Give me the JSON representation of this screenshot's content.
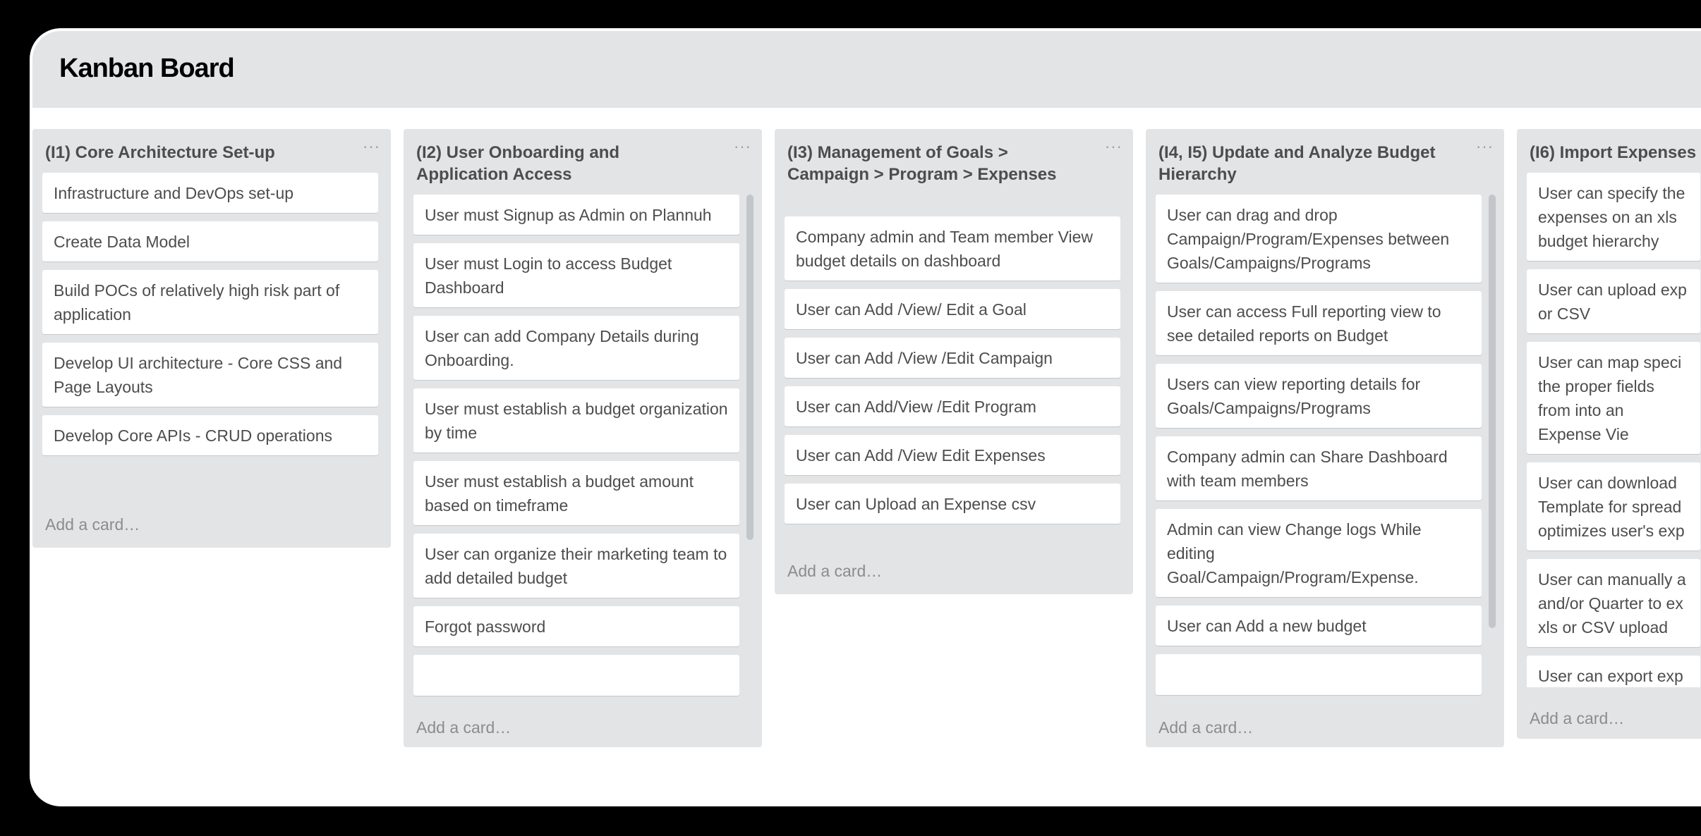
{
  "board": {
    "title": "Kanban Board"
  },
  "menu_glyph": "···",
  "add_card_label": "Add a card…",
  "columns": [
    {
      "title": "(I1) Core Architecture Set-up",
      "cards": [
        "Infrastructure and DevOps set-up",
        "Create Data Model",
        "Build POCs of relatively high risk part of application",
        "Develop UI architecture - Core CSS and Page Layouts",
        "Develop Core APIs - CRUD operations"
      ]
    },
    {
      "title": "(I2) User Onboarding and Application Access",
      "cards": [
        "User must Signup as Admin on Plannuh",
        "User must Login to access Budget Dashboard",
        "User can add Company Details during Onboarding.",
        "User must establish a budget organization by time",
        "User must establish a budget amount based on timeframe",
        "User can organize their marketing team to add detailed budget",
        "Forgot password",
        ""
      ]
    },
    {
      "title": "(I3) Management of Goals > Campaign > Program > Expenses",
      "cards": [
        "Company admin and Team member View budget details on dashboard",
        "User can Add /View/ Edit a Goal",
        "User can Add /View /Edit Campaign",
        "User can Add/View /Edit Program",
        "User can Add /View Edit Expenses",
        "User can Upload an Expense csv"
      ]
    },
    {
      "title": "(I4, I5) Update and Analyze Budget Hierarchy",
      "cards": [
        "User can drag and drop Campaign/Program/Expenses between Goals/Campaigns/Programs",
        "User can access Full reporting view to see detailed reports on Budget",
        "Users can view reporting details for Goals/Campaigns/Programs",
        "Company admin can Share Dashboard with team members",
        "Admin can view Change logs While editing Goal/Campaign/Program/Expense.",
        "User can Add a new budget",
        ""
      ]
    },
    {
      "title": "(I6) Import Expenses",
      "cards": [
        "User can specify the expenses on an xls budget hierarchy",
        "User can upload exp or CSV",
        "User can map speci the proper fields from into an Expense Vie",
        "User can download Template for spread optimizes user's exp",
        "User can manually a and/or Quarter to ex xls or CSV upload",
        "User can export exp"
      ]
    }
  ]
}
